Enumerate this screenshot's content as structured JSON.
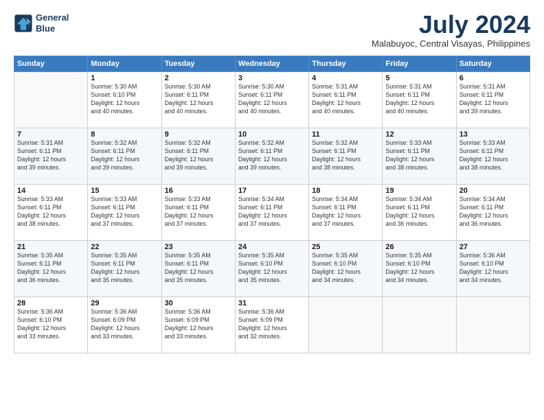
{
  "logo": {
    "line1": "General",
    "line2": "Blue"
  },
  "title": "July 2024",
  "location": "Malabuyoc, Central Visayas, Philippines",
  "weekdays": [
    "Sunday",
    "Monday",
    "Tuesday",
    "Wednesday",
    "Thursday",
    "Friday",
    "Saturday"
  ],
  "weeks": [
    [
      {
        "day": "",
        "info": ""
      },
      {
        "day": "1",
        "info": "Sunrise: 5:30 AM\nSunset: 6:10 PM\nDaylight: 12 hours\nand 40 minutes."
      },
      {
        "day": "2",
        "info": "Sunrise: 5:30 AM\nSunset: 6:11 PM\nDaylight: 12 hours\nand 40 minutes."
      },
      {
        "day": "3",
        "info": "Sunrise: 5:30 AM\nSunset: 6:11 PM\nDaylight: 12 hours\nand 40 minutes."
      },
      {
        "day": "4",
        "info": "Sunrise: 5:31 AM\nSunset: 6:11 PM\nDaylight: 12 hours\nand 40 minutes."
      },
      {
        "day": "5",
        "info": "Sunrise: 5:31 AM\nSunset: 6:11 PM\nDaylight: 12 hours\nand 40 minutes."
      },
      {
        "day": "6",
        "info": "Sunrise: 5:31 AM\nSunset: 6:11 PM\nDaylight: 12 hours\nand 39 minutes."
      }
    ],
    [
      {
        "day": "7",
        "info": "Sunrise: 5:31 AM\nSunset: 6:11 PM\nDaylight: 12 hours\nand 39 minutes."
      },
      {
        "day": "8",
        "info": "Sunrise: 5:32 AM\nSunset: 6:11 PM\nDaylight: 12 hours\nand 39 minutes."
      },
      {
        "day": "9",
        "info": "Sunrise: 5:32 AM\nSunset: 6:11 PM\nDaylight: 12 hours\nand 39 minutes."
      },
      {
        "day": "10",
        "info": "Sunrise: 5:32 AM\nSunset: 6:11 PM\nDaylight: 12 hours\nand 39 minutes."
      },
      {
        "day": "11",
        "info": "Sunrise: 5:32 AM\nSunset: 6:11 PM\nDaylight: 12 hours\nand 38 minutes."
      },
      {
        "day": "12",
        "info": "Sunrise: 5:33 AM\nSunset: 6:11 PM\nDaylight: 12 hours\nand 38 minutes."
      },
      {
        "day": "13",
        "info": "Sunrise: 5:33 AM\nSunset: 6:11 PM\nDaylight: 12 hours\nand 38 minutes."
      }
    ],
    [
      {
        "day": "14",
        "info": "Sunrise: 5:33 AM\nSunset: 6:11 PM\nDaylight: 12 hours\nand 38 minutes."
      },
      {
        "day": "15",
        "info": "Sunrise: 5:33 AM\nSunset: 6:11 PM\nDaylight: 12 hours\nand 37 minutes."
      },
      {
        "day": "16",
        "info": "Sunrise: 5:33 AM\nSunset: 6:11 PM\nDaylight: 12 hours\nand 37 minutes."
      },
      {
        "day": "17",
        "info": "Sunrise: 5:34 AM\nSunset: 6:11 PM\nDaylight: 12 hours\nand 37 minutes."
      },
      {
        "day": "18",
        "info": "Sunrise: 5:34 AM\nSunset: 6:11 PM\nDaylight: 12 hours\nand 37 minutes."
      },
      {
        "day": "19",
        "info": "Sunrise: 5:34 AM\nSunset: 6:11 PM\nDaylight: 12 hours\nand 36 minutes."
      },
      {
        "day": "20",
        "info": "Sunrise: 5:34 AM\nSunset: 6:11 PM\nDaylight: 12 hours\nand 36 minutes."
      }
    ],
    [
      {
        "day": "21",
        "info": "Sunrise: 5:35 AM\nSunset: 6:11 PM\nDaylight: 12 hours\nand 36 minutes."
      },
      {
        "day": "22",
        "info": "Sunrise: 5:35 AM\nSunset: 6:11 PM\nDaylight: 12 hours\nand 35 minutes."
      },
      {
        "day": "23",
        "info": "Sunrise: 5:35 AM\nSunset: 6:11 PM\nDaylight: 12 hours\nand 35 minutes."
      },
      {
        "day": "24",
        "info": "Sunrise: 5:35 AM\nSunset: 6:10 PM\nDaylight: 12 hours\nand 35 minutes."
      },
      {
        "day": "25",
        "info": "Sunrise: 5:35 AM\nSunset: 6:10 PM\nDaylight: 12 hours\nand 34 minutes."
      },
      {
        "day": "26",
        "info": "Sunrise: 5:35 AM\nSunset: 6:10 PM\nDaylight: 12 hours\nand 34 minutes."
      },
      {
        "day": "27",
        "info": "Sunrise: 5:36 AM\nSunset: 6:10 PM\nDaylight: 12 hours\nand 34 minutes."
      }
    ],
    [
      {
        "day": "28",
        "info": "Sunrise: 5:36 AM\nSunset: 6:10 PM\nDaylight: 12 hours\nand 33 minutes."
      },
      {
        "day": "29",
        "info": "Sunrise: 5:36 AM\nSunset: 6:09 PM\nDaylight: 12 hours\nand 33 minutes."
      },
      {
        "day": "30",
        "info": "Sunrise: 5:36 AM\nSunset: 6:09 PM\nDaylight: 12 hours\nand 33 minutes."
      },
      {
        "day": "31",
        "info": "Sunrise: 5:36 AM\nSunset: 6:09 PM\nDaylight: 12 hours\nand 32 minutes."
      },
      {
        "day": "",
        "info": ""
      },
      {
        "day": "",
        "info": ""
      },
      {
        "day": "",
        "info": ""
      }
    ]
  ]
}
